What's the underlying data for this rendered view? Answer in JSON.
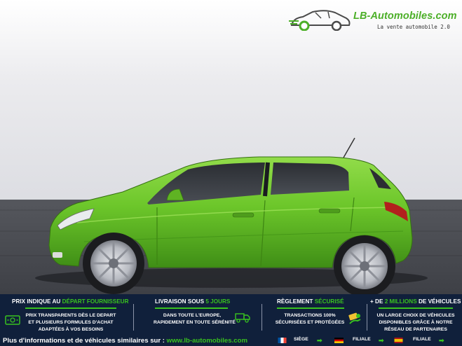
{
  "brand": {
    "name": "LB-Automobiles.com",
    "tagline": "La vente automobile 2.0"
  },
  "colors": {
    "accent": "#39c21f",
    "banner_bg": "#10203b",
    "car_body": "#6cc62a"
  },
  "features": [
    {
      "title_prefix": "PRIX INDIQUE AU ",
      "title_highlight": "DÉPART FOURNISSEUR",
      "title_suffix": "",
      "line1": "PRIX TRANSPARENTS DÈS LE DEPART",
      "line2": "ET PLUSIEURS FORMULES D'ACHAT",
      "line3": "ADAPTÉES À VOS BESOINS",
      "icon": "money-icon"
    },
    {
      "title_prefix": "LIVRAISON SOUS ",
      "title_highlight": "5 JOURS",
      "title_suffix": "",
      "line1": "DANS TOUTE L'EUROPE,",
      "line2": "RAPIDEMENT EN TOUTE SÉRÉNITÉ",
      "line3": "",
      "icon": "delivery-truck-icon"
    },
    {
      "title_prefix": "RÈGLEMENT ",
      "title_highlight": "SÉCURISÉ",
      "title_suffix": "",
      "line1": "TRANSACTIONS 100%",
      "line2": "SÉCURISÉES ET PROTÉGÉES",
      "line3": "",
      "icon": "secure-payment-icon"
    },
    {
      "title_prefix": "+ DE ",
      "title_highlight": "2 MILLIONS",
      "title_suffix": " DE VÉHICULES",
      "line1": "UN LARGE CHOIX DE VÉHICULES",
      "line2": "DISPONIBLES GRÂCE À NOTRE",
      "line3": "RÉSEAU DE PARTENAIRES",
      "icon": ""
    }
  ],
  "footer": {
    "text": "Plus d'informations et de véhicules similaires sur : ",
    "url": "www.lb-automobiles.com",
    "siege": "SIÈGE",
    "filiale1": "FILIALE",
    "filiale2": "FILIALE"
  }
}
